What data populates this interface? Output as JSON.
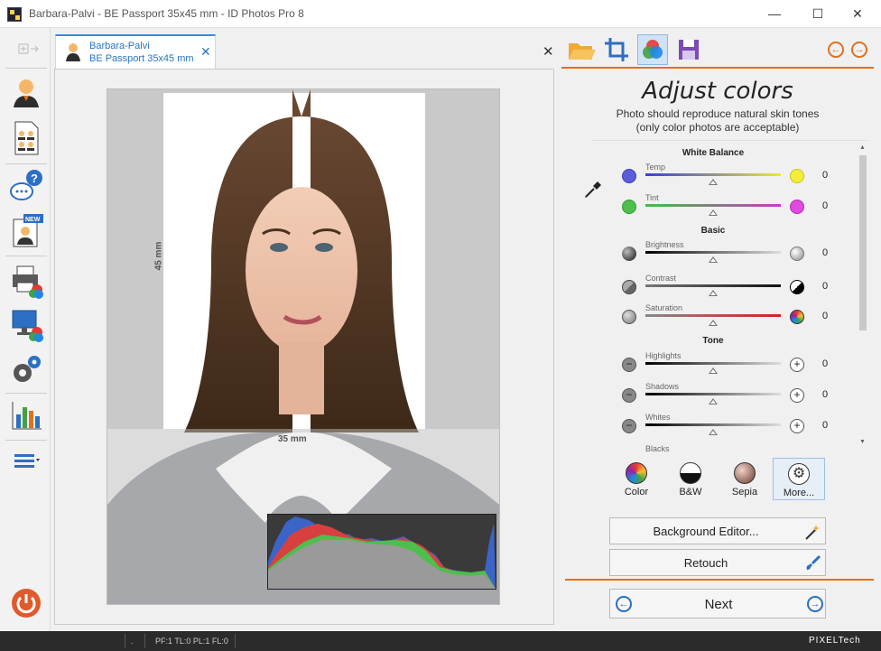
{
  "window": {
    "title": "Barbara-Palvi - BE Passport 35x45 mm - ID Photos Pro 8",
    "minimize": "—",
    "maximize": "☐",
    "close": "✕"
  },
  "tab": {
    "name": "Barbara-Palvi",
    "format": "BE Passport 35x45 mm",
    "close": "✕"
  },
  "panel_close": "✕",
  "photo": {
    "height_label": "45 mm",
    "width_label": "35 mm"
  },
  "right_panel": {
    "title": "Adjust colors",
    "subtitle_line1": "Photo should reproduce natural skin tones",
    "subtitle_line2": "(only color photos are acceptable)",
    "nav_prev": "←",
    "nav_next": "→"
  },
  "adjust": {
    "white_balance": "White Balance",
    "basic": "Basic",
    "tone": "Tone",
    "temp": {
      "label": "Temp",
      "value": "0"
    },
    "tint": {
      "label": "Tint",
      "value": "0"
    },
    "brightness": {
      "label": "Brightness",
      "value": "0"
    },
    "contrast": {
      "label": "Contrast",
      "value": "0"
    },
    "saturation": {
      "label": "Saturation",
      "value": "0"
    },
    "highlights": {
      "label": "Highlights",
      "value": "0"
    },
    "shadows": {
      "label": "Shadows",
      "value": "0"
    },
    "whites": {
      "label": "Whites",
      "value": "0"
    },
    "blacks": {
      "label": "Blacks",
      "value": ""
    }
  },
  "presets": {
    "color": "Color",
    "bw": "B&W",
    "sepia": "Sepia",
    "more": "More..."
  },
  "buttons": {
    "background_editor": "Background Editor...",
    "retouch": "Retouch",
    "next": "Next"
  },
  "status": {
    "dot": ".",
    "info": "PF:1 TL:0 PL:1 FL:0",
    "brand": "PIXELTech"
  }
}
